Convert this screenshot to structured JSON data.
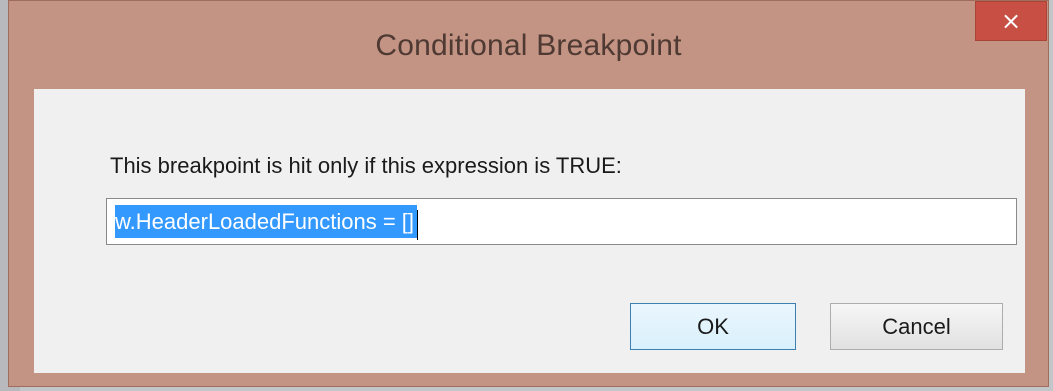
{
  "dialog": {
    "title": "Conditional Breakpoint",
    "close_label": "×",
    "prompt": "This breakpoint is hit only if this expression is TRUE:",
    "expression_value": "w.HeaderLoadedFunctions = []",
    "buttons": {
      "ok": "OK",
      "cancel": "Cancel"
    }
  },
  "colors": {
    "title_bar": "#c39383",
    "close_button": "#c74f43",
    "selection": "#3399ff",
    "client_background": "#f0f0f0"
  },
  "icons": {
    "close": "close-icon"
  }
}
